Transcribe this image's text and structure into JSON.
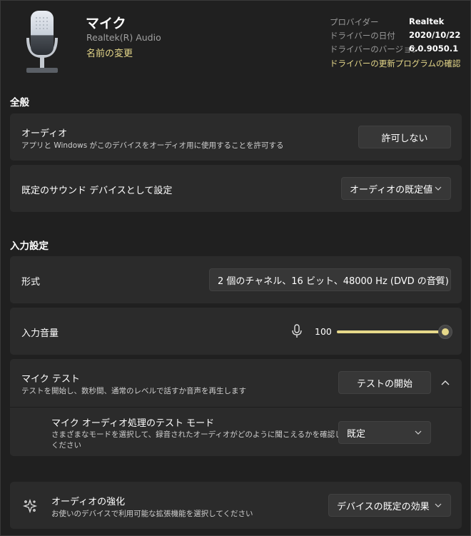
{
  "header": {
    "title": "マイク",
    "subtitle": "Realtek(R) Audio",
    "rename_link": "名前の変更",
    "icon": "microphone-device-icon"
  },
  "driver_info": {
    "provider_label": "プロバイダー",
    "provider_value": "Realtek",
    "date_label": "ドライバーの日付",
    "date_value": "2020/10/22",
    "version_label": "ドライバーのバージョン",
    "version_value": "6.0.9050.1",
    "update_link": "ドライバーの更新プログラムの確認"
  },
  "general": {
    "section_title": "全般",
    "audio": {
      "title": "オーディオ",
      "description": "アプリと Windows がこのデバイスをオーディオ用に使用することを許可する",
      "button_label": "許可しない"
    },
    "default_device": {
      "title": "既定のサウンド デバイスとして設定",
      "selected": "オーディオの既定値"
    }
  },
  "input_settings": {
    "section_title": "入力設定",
    "format": {
      "title": "形式",
      "selected": "2 個のチャネル、16 ビット、48000 Hz (DVD の音質)"
    },
    "volume": {
      "title": "入力音量",
      "value": "100",
      "level_fraction": 1.0,
      "icon": "microphone-icon"
    },
    "mic_test": {
      "title": "マイク テスト",
      "description": "テストを開始し、数秒間、通常のレベルで話すか音声を再生します",
      "button_label": "テストの開始",
      "expanded": true
    },
    "test_mode": {
      "title": "マイク オーディオ処理のテスト モード",
      "description_line1": "さまざまなモードを選択して、録音されたオーディオがどのように聞こえるかを確認して",
      "description_line2": "ください",
      "selected": "既定"
    }
  },
  "enhancements": {
    "title": "オーディオの強化",
    "description": "お使いのデバイスで利用可能な拡張機能を選択してください",
    "selected": "デバイスの既定の効果",
    "icon": "sparkle-icon"
  },
  "colors": {
    "background": "#202020",
    "card": "#2b2b2b",
    "accent": "#e6d88a"
  }
}
